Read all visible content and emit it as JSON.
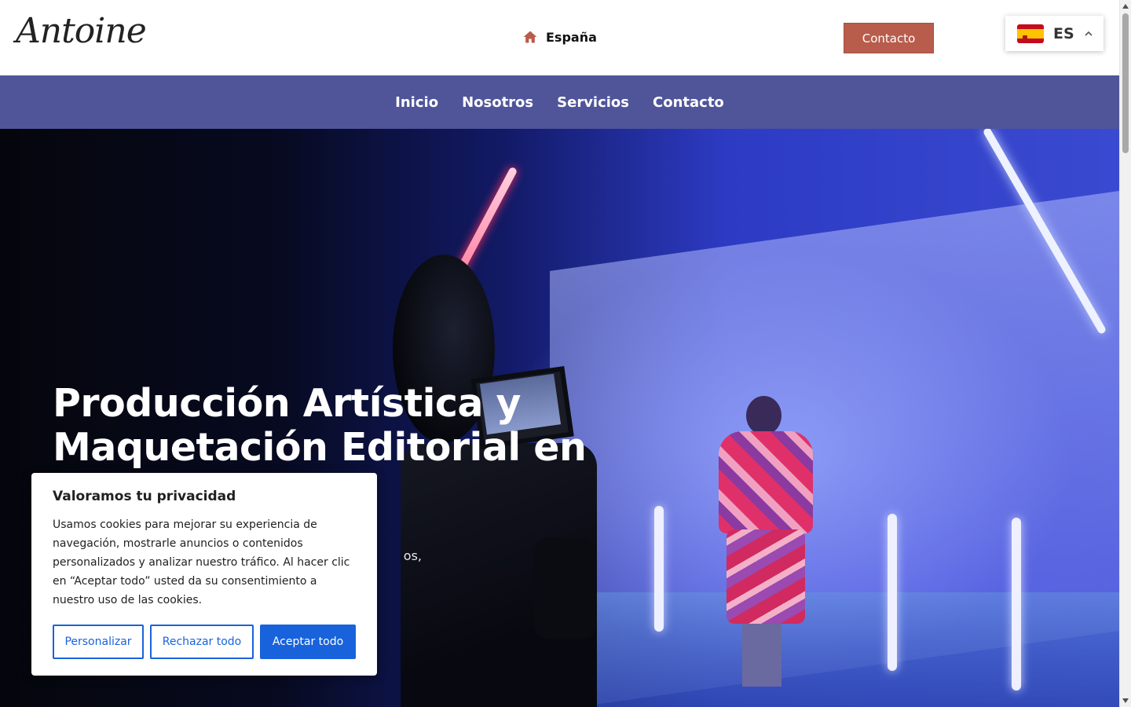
{
  "header": {
    "logo": "Antoine",
    "location": "España",
    "contact_button": "Contacto",
    "language": {
      "code": "ES",
      "flag": "spain-flag-icon"
    }
  },
  "nav": {
    "items": [
      {
        "label": "Inicio"
      },
      {
        "label": "Nosotros"
      },
      {
        "label": "Servicios"
      },
      {
        "label": "Contacto"
      }
    ]
  },
  "hero": {
    "title": "Producción Artística y Maquetación Editorial en",
    "subtitle_visible": "os,"
  },
  "cookie": {
    "title": "Valoramos tu privacidad",
    "text": "Usamos cookies para mejorar su experiencia de navegación, mostrarle anuncios o contenidos personalizados y analizar nuestro tráfico. Al hacer clic en “Aceptar todo” usted da su consentimiento a nuestro uso de las cookies.",
    "buttons": {
      "customize": "Personalizar",
      "reject": "Rechazar todo",
      "accept": "Aceptar todo"
    }
  },
  "colors": {
    "nav_bg": "#50559a",
    "contact_button_bg": "#b85c4c",
    "cookie_accent": "#1863dc"
  }
}
